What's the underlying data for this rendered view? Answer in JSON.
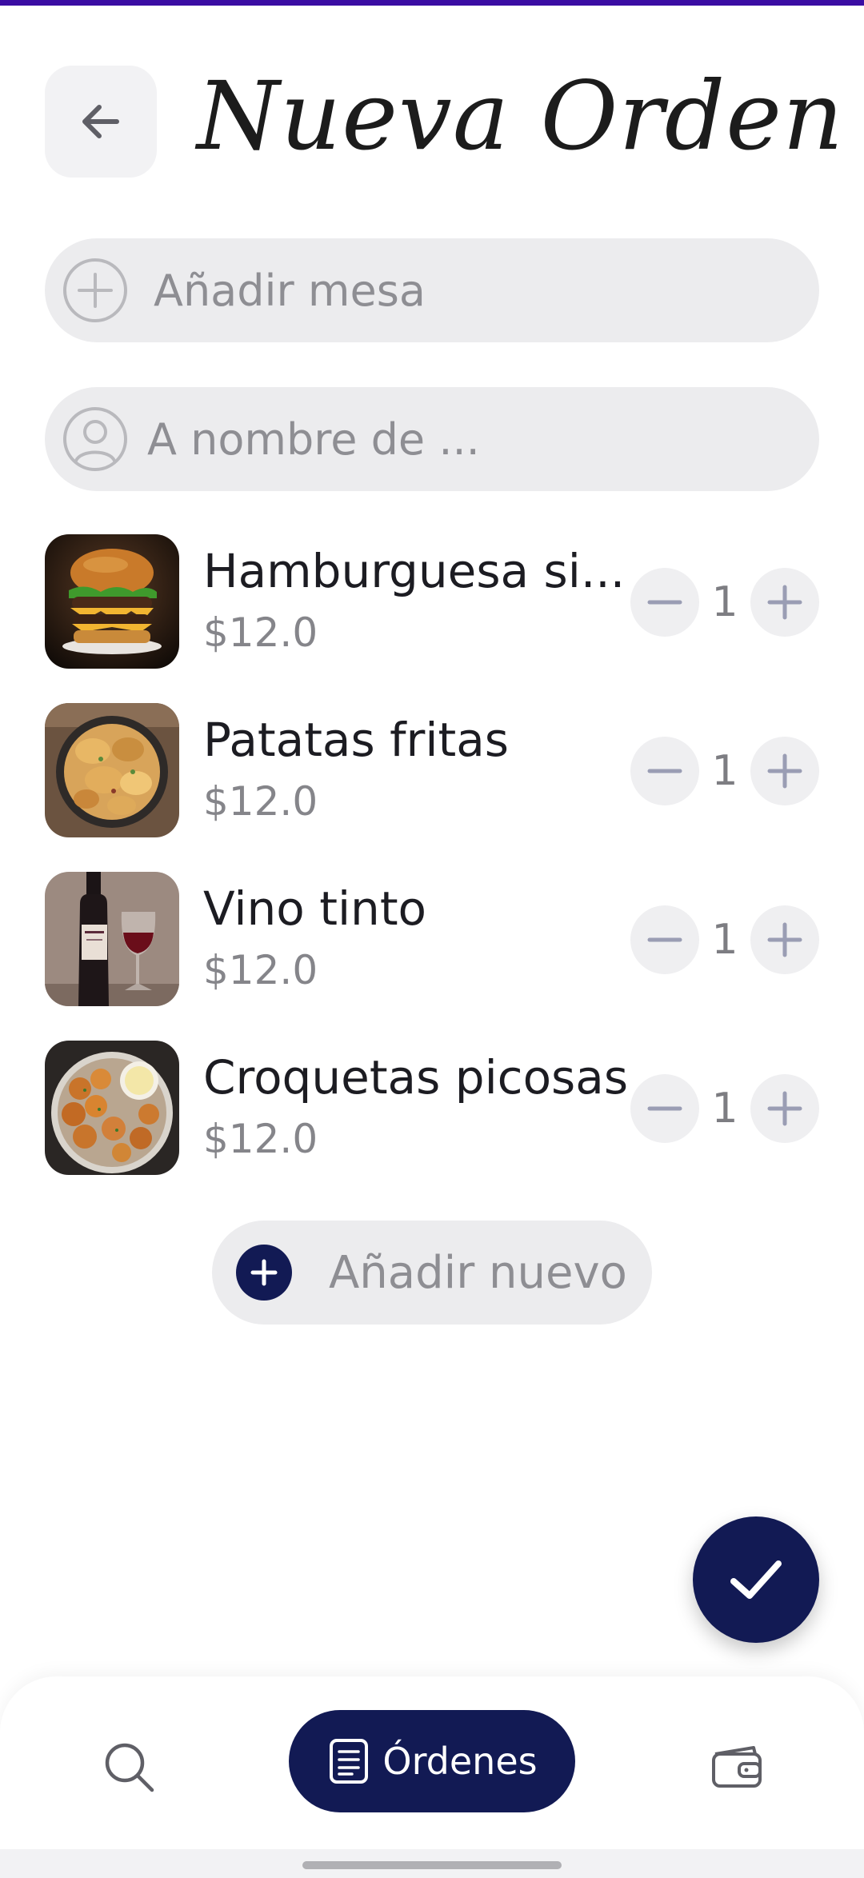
{
  "header": {
    "title": "Nueva Orden",
    "back_icon": "arrow-left-icon"
  },
  "fields": {
    "table": {
      "placeholder": "Añadir mesa",
      "icon": "plus-circle-icon"
    },
    "customer": {
      "placeholder": "A nombre de ...",
      "icon": "user-circle-icon"
    }
  },
  "items": [
    {
      "name": "Hamburguesa si...",
      "price": "$12.0",
      "quantity": "1",
      "image": "burger-photo"
    },
    {
      "name": "Patatas fritas",
      "price": "$12.0",
      "quantity": "1",
      "image": "potato-chips-photo"
    },
    {
      "name": "Vino tinto",
      "price": "$12.0",
      "quantity": "1",
      "image": "red-wine-photo"
    },
    {
      "name": "Croquetas picosas",
      "price": "$12.0",
      "quantity": "1",
      "image": "croquettes-photo"
    }
  ],
  "add_new": {
    "label": "Añadir nuevo",
    "icon": "plus-icon"
  },
  "fab": {
    "icon": "check-icon"
  },
  "bottom_nav": {
    "search_icon": "search-icon",
    "orders_label": "Órdenes",
    "orders_icon": "document-icon",
    "wallet_icon": "wallet-icon"
  },
  "colors": {
    "accent": "#121a54",
    "status_bar_strip": "#3a0ca3",
    "field_bg": "#ececee",
    "placeholder": "#8e8e93"
  }
}
